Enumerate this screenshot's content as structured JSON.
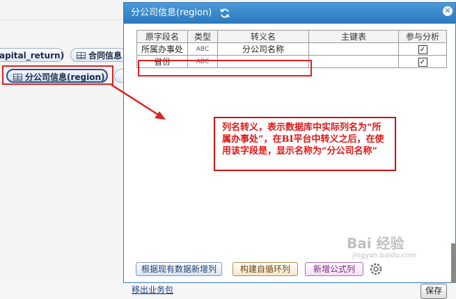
{
  "background": {
    "tables": [
      {
        "label": "apital_return)"
      },
      {
        "label": "合同信息"
      },
      {
        "label": "分公司信息(region)"
      },
      {
        "label": ""
      }
    ]
  },
  "dialog": {
    "title": "分公司信息(region)",
    "close_glyph": "✕",
    "columns": [
      "原字段名",
      "类型",
      "转义名",
      "主键表",
      "参与分析"
    ],
    "rows": [
      {
        "field": "所属办事处",
        "type": "ABC",
        "alias": "分公司名称",
        "pk": "",
        "analysis": "✓"
      },
      {
        "field": "省份",
        "type": "ABC",
        "alias": "",
        "pk": "",
        "analysis": "✓"
      }
    ],
    "callout": "列名转义，表示数据库中实际列名为“所属办事处”，在BI平台中转义之后，在使用该字段是，显示名称为“分公司名称”",
    "buttons": {
      "add_column": "根据现有数据新增列",
      "build_loop": "构建自循环列",
      "add_formula": "新增公式列"
    },
    "exit_link": "移出业务包",
    "save": "保存"
  },
  "watermark": {
    "main": "Bai 经验",
    "sub": "jingyan.baidu.com"
  },
  "colors": {
    "annotation": "#e02020",
    "title_bar": "#2a78be"
  }
}
